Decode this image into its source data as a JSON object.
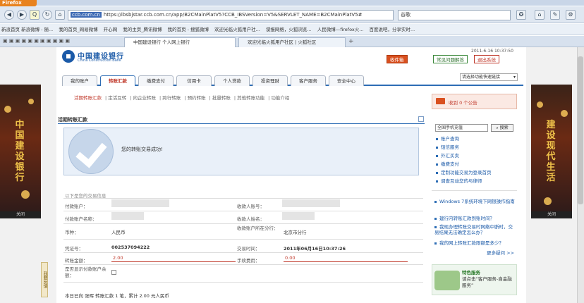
{
  "browser": {
    "app_button": "Firefox",
    "url": "https://ibsbjstar.ccb.com.cn/app/B2CMainPlatV5?CCB_IBSVersion=V5&SERVLET_NAME=B2CMainPlatV5#",
    "url_highlight": "ccb.com.cn",
    "search_text": "谷歌",
    "bookmarks": [
      "新浪首页 新浪微博 - 随...",
      "我的首页_网易微博",
      "开心网",
      "我的主页_腾讯微博",
      "我的首页 - 搜狐微博",
      "欢迎光临火狐用户社...",
      "谍报网络，火狐浏览...",
      "人民微博—firefox火...",
      "百度说吧，分享实时..."
    ],
    "tabs": [
      "中国建设银行 个人网上银行",
      "欢迎光临火狐用户社区 | 火狐社区"
    ]
  },
  "header": {
    "logo_cn": "中国建设银行",
    "logo_en": "China Construction Bank",
    "date": "2011-6-16 10:37:50",
    "mail_button": "收件箱",
    "help_button": "常见问题解答",
    "exit_button": "退出系统"
  },
  "menu": {
    "tabs": [
      "我的账户",
      "转账汇款",
      "缴费支付",
      "信用卡",
      "个人贷款",
      "投资理财",
      "客户服务",
      "安全中心"
    ],
    "active_index": 1,
    "quick_nav": "请选择功能快速链接"
  },
  "subnav": [
    "活期转账汇款",
    "定活互转",
    "向企业转账",
    "跨行转账",
    "预约转账",
    "批量转账",
    "其他转账功能",
    "功能介绍"
  ],
  "section": {
    "title": "活期转账汇款"
  },
  "success": {
    "message": "您的转账交易成功!"
  },
  "details": {
    "heading": "以下是您的交易信息",
    "labels": {
      "payer_account": "付款账户：",
      "payee_account": "收款人账号：",
      "payer_name": "付款账户名称：",
      "payee_name": "收款人姓名：",
      "currency": "币种：",
      "payee_branch": "收款账户所在分行：",
      "voucher": "凭证号：",
      "trade_time": "交易时间：",
      "amount": "转账金额：",
      "fee": "手续费用：",
      "show_payer": "是否显示付款账户余额："
    },
    "values": {
      "currency": "人民币",
      "payee_branch": "北京市分行",
      "voucher": "002537094222",
      "trade_time": "2011年06月16日10:37:26",
      "amount": "2.00",
      "fee": "0.00"
    },
    "summary": "本日已向 张晖 转账汇款 1 笔，累计 2.00 元人民币"
  },
  "right": {
    "notice": "收到 0 个公告",
    "search_placeholder": "全国手机充值",
    "search_button": "搜索",
    "links": [
      "账户查询",
      "短信服务",
      "外汇买卖",
      "缴费支付",
      "定制功能交易为登录首页",
      "调查互动您的与律师"
    ],
    "news": [
      "Windows 7系统环境下网银操作指南",
      "建行内转账汇款到账时间？",
      "我现办理转账交易时网络中断时，交易结果无法确定怎么办？",
      "我的网上转账汇款限额是多少？"
    ],
    "more": "更多疑问 >>",
    "service_title": "特色服务",
    "service_text": "请点击“客户服务-自金融服务”"
  },
  "banners": {
    "left_text": "中国建设银行",
    "right_text": "建设现代生活",
    "close": "关闭"
  },
  "side_tag": "我要反馈"
}
